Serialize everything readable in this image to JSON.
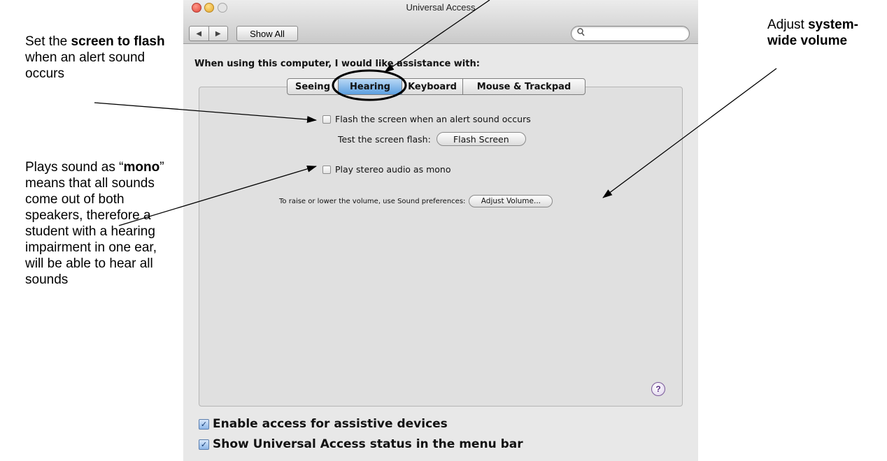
{
  "annotations": {
    "flash": {
      "pre": "Set the ",
      "bold": "screen to flash",
      "post": " when an alert sound occurs"
    },
    "mono": {
      "pre": "Plays sound as “",
      "bold": "mono",
      "post": "” means that all sounds come out of both speakers, therefore a student with a hearing impairment in one ear, will be able to hear all sounds"
    },
    "volume": {
      "pre": "Adjust ",
      "bold": "system-wide volume",
      "post": ""
    }
  },
  "window": {
    "title": "Universal Access",
    "nav_back_icon": "◀",
    "nav_forward_icon": "▶",
    "show_all": "Show All",
    "search": {
      "placeholder": "",
      "icon": "search-icon"
    }
  },
  "prompt": "When using this computer, I would like assistance with:",
  "tabs": [
    {
      "label": "Seeing",
      "selected": false
    },
    {
      "label": "Hearing",
      "selected": true
    },
    {
      "label": "Keyboard",
      "selected": false
    },
    {
      "label": "Mouse & Trackpad",
      "selected": false
    }
  ],
  "hearing": {
    "flash_checkbox": {
      "label": "Flash the screen when an alert sound occurs",
      "checked": false
    },
    "test_label": "Test the screen flash:",
    "flash_button": "Flash Screen",
    "mono_checkbox": {
      "label": "Play stereo audio as mono",
      "checked": false
    },
    "volume_label": "To raise or lower the volume, use Sound preferences:",
    "adjust_button": "Adjust Volume...",
    "help_glyph": "?"
  },
  "options": {
    "assistive": {
      "label": "Enable access for assistive devices",
      "checked": true
    },
    "status": {
      "label": "Show Universal Access status in the menu bar",
      "checked": true
    }
  },
  "colors": {
    "selected_tab": "#5c9fe0",
    "checkbox_checked": "#8db6e8"
  }
}
